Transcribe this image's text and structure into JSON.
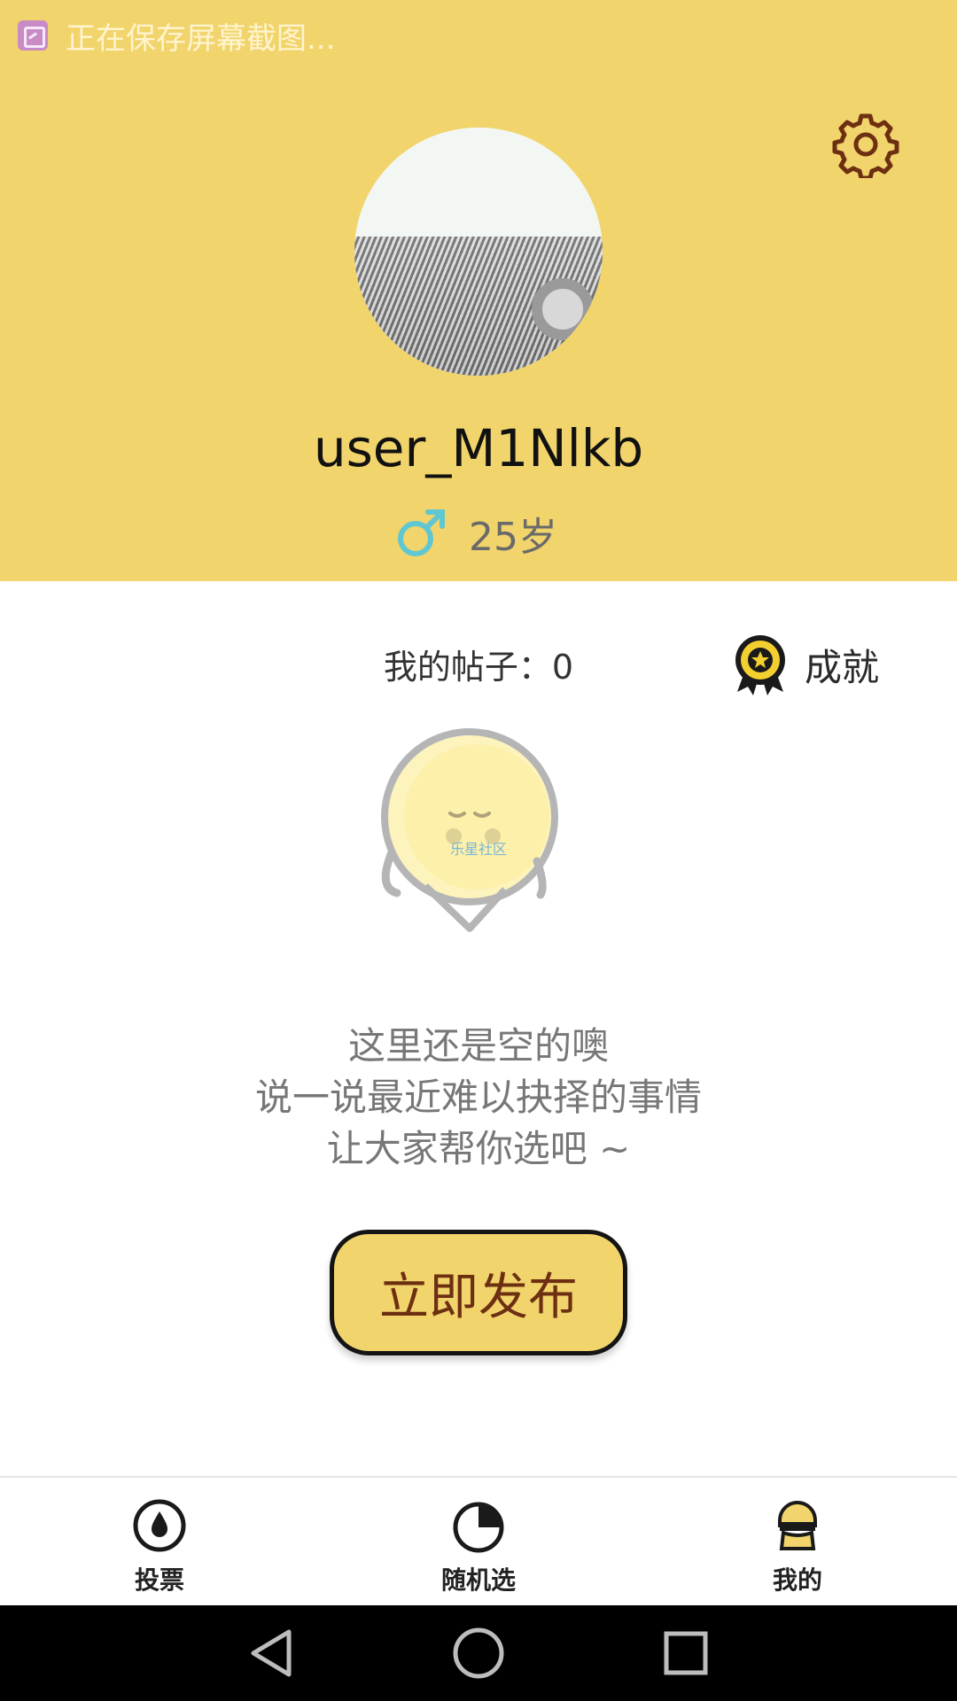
{
  "status_bar": {
    "notification_text": "正在保存屏幕截图...",
    "icon": "screenshot-icon"
  },
  "header": {
    "background_color": "#f1d46b",
    "settings_icon": "gear-icon",
    "avatar_icon": "avatar-image",
    "username": "user_M1Nlkb",
    "gender_icon": "male-icon",
    "gender_color": "#5fc7d2",
    "age": "25岁"
  },
  "stats": {
    "posts_label": "我的帖子：0",
    "achievement_icon": "medal-icon",
    "achievement_label": "成就"
  },
  "empty_state": {
    "illustration_icon": "sad-face-illustration",
    "illustration_watermark": "乐星社区",
    "line1": "这里还是空的噢",
    "line2": "说一说最近难以抉择的事情",
    "line3": "让大家帮你选吧 ~"
  },
  "actions": {
    "publish_label": "立即发布"
  },
  "tabs": [
    {
      "label": "投票",
      "icon": "vote-drop-icon",
      "active": false
    },
    {
      "label": "随机选",
      "icon": "pie-chart-icon",
      "active": false
    },
    {
      "label": "我的",
      "icon": "profile-icon",
      "active": true
    }
  ],
  "navigation": {
    "back_icon": "back-triangle-icon",
    "home_icon": "home-circle-icon",
    "recents_icon": "recents-square-icon"
  }
}
